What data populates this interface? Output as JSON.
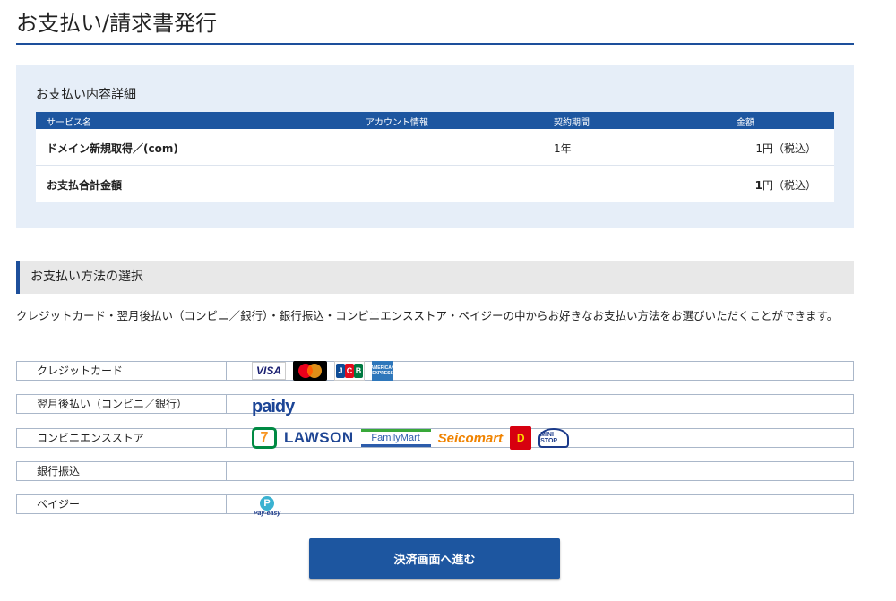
{
  "page_title": "お支払い/請求書発行",
  "details": {
    "heading": "お支払い内容詳細",
    "columns": [
      "サービス名",
      "アカウント情報",
      "契約期間",
      "金額"
    ],
    "rows": [
      {
        "service": "ドメイン新規取得／(com)",
        "account": "",
        "period": "1年",
        "amount": "1円（税込）"
      }
    ],
    "total": {
      "label": "お支払合計金額",
      "amount_value": "1",
      "amount_suffix": "円（税込）"
    }
  },
  "payment": {
    "heading": "お支払い方法の選択",
    "intro": "クレジットカード・翌月後払い（コンビニ／銀行）・銀行振込・コンビニエンスストア・ペイジーの中からお好きなお支払い方法をお選びいただくことができます。",
    "methods": [
      {
        "label": "クレジットカード",
        "logos": [
          "visa-logo",
          "mastercard-logo",
          "jcb-logo",
          "amex-logo"
        ]
      },
      {
        "label": "翌月後払い（コンビニ／銀行）",
        "logos": [
          "paidy-logo"
        ]
      },
      {
        "label": "コンビニエンスストア",
        "logos": [
          "seven-eleven-logo",
          "lawson-logo",
          "familymart-logo",
          "seicomart-logo",
          "daily-yamazaki-logo",
          "ministop-logo"
        ]
      },
      {
        "label": "銀行振込",
        "logos": []
      },
      {
        "label": "ペイジー",
        "logos": [
          "pay-easy-logo"
        ]
      }
    ]
  },
  "logo_text": {
    "visa": "VISA",
    "jcb": [
      "J",
      "C",
      "B"
    ],
    "amex": "AMERICAN EXPRESS",
    "paidy": "paidy",
    "seven": "7",
    "lawson": "LAWSON",
    "familymart": "FamilyMart",
    "seicomart": "Seicomart",
    "daily": "D",
    "ministop": "MINI STOP",
    "payeasy_mark": "P",
    "payeasy": "Pay-easy"
  },
  "proceed_button": "決済画面へ進む",
  "colors": {
    "accent": "#1d56a0",
    "panel": "#e6eef8",
    "rule": "#1d4f9b"
  }
}
